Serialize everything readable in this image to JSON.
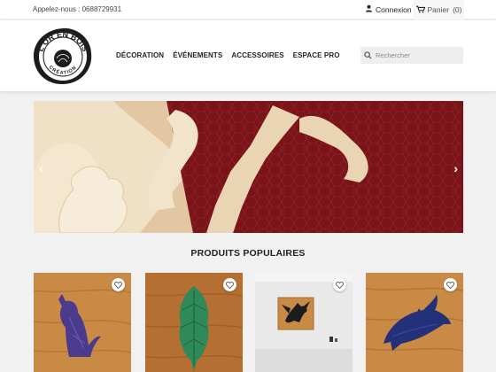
{
  "topbar": {
    "phone_text": "Appelez-nous : 0688729931",
    "login_label": "Connexion",
    "cart_label": "Panier",
    "cart_count": "(0)"
  },
  "header": {
    "logo_text_top": "L'OR EN BOIS",
    "logo_text_bottom": "CRÉATION",
    "nav": [
      {
        "label": "DÉCORATION"
      },
      {
        "label": "ÉVÉNEMENTS"
      },
      {
        "label": "ACCESSOIRES"
      },
      {
        "label": "ESPACE PRO"
      }
    ],
    "search_placeholder": "Rechercher"
  },
  "slider": {
    "prev_icon": "chevron-left",
    "next_icon": "chevron-right"
  },
  "section": {
    "title": "PRODUITS POPULAIRES"
  },
  "products": [
    {
      "image": "cat-silhouette-on-wood"
    },
    {
      "image": "leaf-on-wood"
    },
    {
      "image": "dragon-frame-photo"
    },
    {
      "image": "dolphin-on-wood"
    }
  ],
  "colors": {
    "wood": "#c98a45",
    "banner_red": "#7a1418",
    "accent_text": "#232323"
  }
}
